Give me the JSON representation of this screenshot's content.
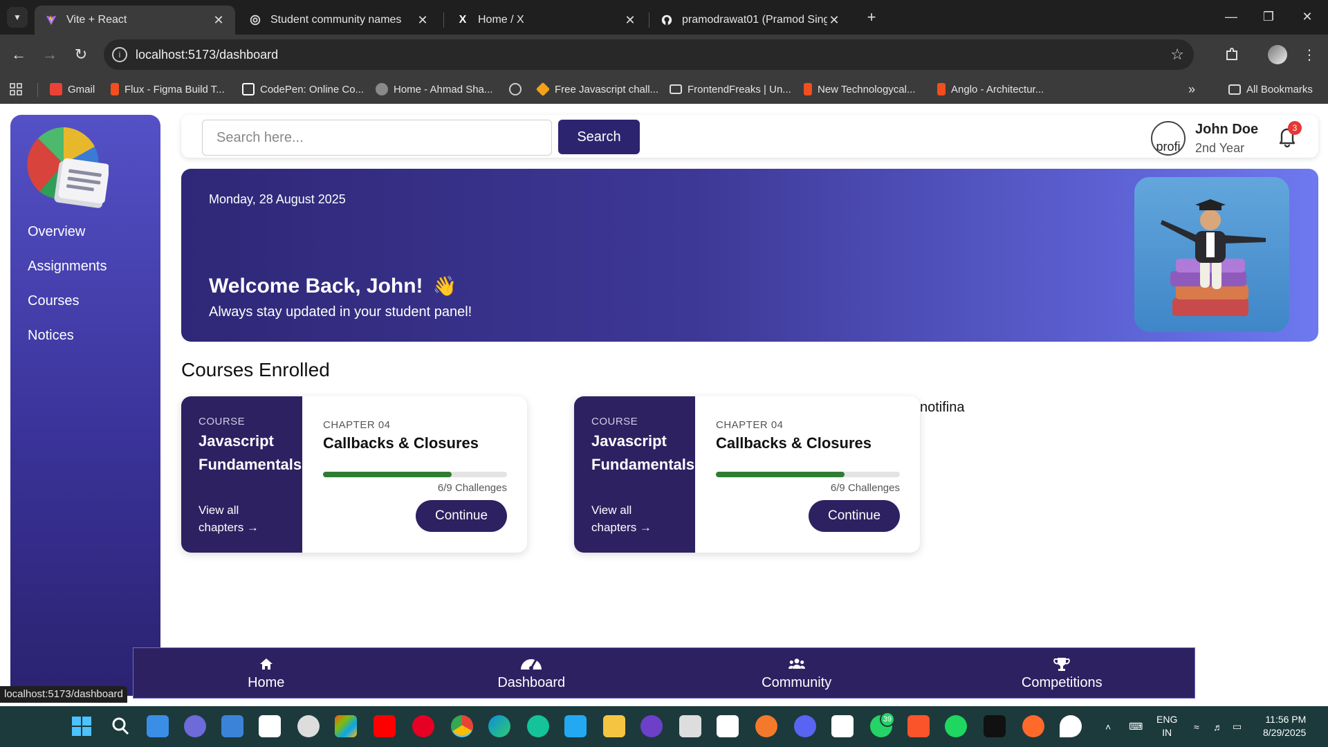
{
  "browser": {
    "tabs": [
      {
        "label": "Vite + React",
        "active": true,
        "icon": "vite-icon"
      },
      {
        "label": "Student community names",
        "active": false,
        "icon": "chatgpt-icon"
      },
      {
        "label": "Home / X",
        "active": false,
        "icon": "x-icon"
      },
      {
        "label": "pramodrawat01 (Pramod Singh",
        "active": false,
        "icon": "github-icon"
      }
    ],
    "url": "localhost:5173/dashboard",
    "bookmarks": [
      {
        "label": "Gmail",
        "icon": "gmail-icon",
        "color": "#ea4335"
      },
      {
        "label": "Flux - Figma Build T...",
        "icon": "figma-icon",
        "color": "#f24e1e"
      },
      {
        "label": "CodePen: Online Co...",
        "icon": "codepen-icon",
        "color": "#ffffff"
      },
      {
        "label": "Home - Ahmad Sha...",
        "icon": "avatar-icon",
        "color": "#8a8a8a"
      },
      {
        "label": "",
        "icon": "globe-icon",
        "color": "#cccccc"
      },
      {
        "label": "Free Javascript chall...",
        "icon": "diamond-icon",
        "color": "#f4a21b"
      },
      {
        "label": "FrontendFreaks | Un...",
        "icon": "ff-icon",
        "color": "#dddddd"
      },
      {
        "label": "New Technologycal...",
        "icon": "figma-icon",
        "color": "#f24e1e"
      },
      {
        "label": "Anglo - Architectur...",
        "icon": "figma-icon",
        "color": "#f24e1e"
      }
    ],
    "all_bookmarks_label": "All Bookmarks",
    "status_url": "localhost:5173/dashboard"
  },
  "sidebar": {
    "items": [
      {
        "label": "Overview"
      },
      {
        "label": "Assignments"
      },
      {
        "label": "Courses"
      },
      {
        "label": "Notices"
      }
    ]
  },
  "topbar": {
    "search_placeholder": "Search here...",
    "search_button": "Search",
    "profile_alt": "profi",
    "user_name": "John Doe",
    "user_year": "2nd Year",
    "notification_count": "3"
  },
  "banner": {
    "date": "Monday, 28 August 2025",
    "welcome": "Welcome Back, John!",
    "subtitle": "Always stay updated in your student panel!"
  },
  "courses": {
    "title": "Courses Enrolled",
    "cards": [
      {
        "kicker": "COURSE",
        "course": "Javascript Fundamentals",
        "link": "View all chapters →",
        "chapter": "CHAPTER 04",
        "chapter_title": "Callbacks & Closures",
        "progress": "6/9 Challenges",
        "progress_fraction": 0.7,
        "button": "Continue"
      },
      {
        "kicker": "COURSE",
        "course": "Javascript Fundamentals",
        "link": "View all chapters →",
        "chapter": "CHAPTER 04",
        "chapter_title": "Callbacks & Closures",
        "progress": "6/9 Challenges",
        "progress_fraction": 0.7,
        "button": "Continue"
      }
    ],
    "stray_text": "notifina"
  },
  "bottom_nav": [
    {
      "label": "Home",
      "icon": "home-icon"
    },
    {
      "label": "Dashboard",
      "icon": "dashboard-gauge-icon"
    },
    {
      "label": "Community",
      "icon": "community-icon"
    },
    {
      "label": "Competitions",
      "icon": "trophy-icon"
    }
  ],
  "taskbar": {
    "language": "ENG",
    "region": "IN",
    "time": "11:56 PM",
    "date": "8/29/2025",
    "whatsapp_badge": "39"
  },
  "colors": {
    "primary": "#2d2161",
    "progress": "#2e7d32",
    "badge": "#e53935"
  }
}
